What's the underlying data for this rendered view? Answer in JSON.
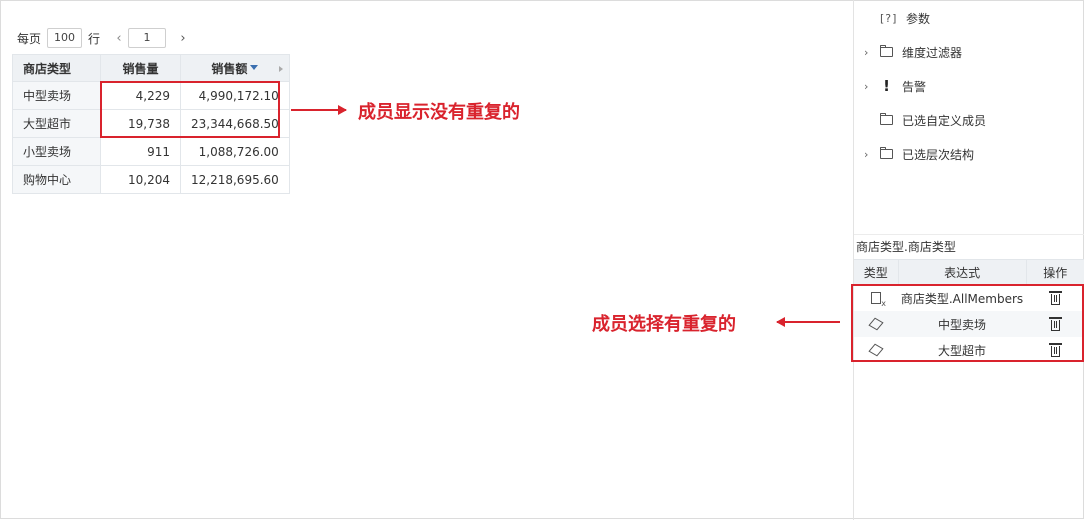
{
  "pager": {
    "prefix": "每页",
    "page_size": "100",
    "suffix": "行",
    "page": "1"
  },
  "table": {
    "headers": [
      "商店类型",
      "销售量",
      "销售额"
    ],
    "rows": [
      {
        "dim": "中型卖场",
        "qty": "4,229",
        "amount": "4,990,172.10"
      },
      {
        "dim": "大型超市",
        "qty": "19,738",
        "amount": "23,344,668.50"
      },
      {
        "dim": "小型卖场",
        "qty": "911",
        "amount": "1,088,726.00"
      },
      {
        "dim": "购物中心",
        "qty": "10,204",
        "amount": "12,218,695.60"
      }
    ]
  },
  "annotations": {
    "display_note": "成员显示没有重复的",
    "select_note": "成员选择有重复的"
  },
  "tree": {
    "param_icon": "[?]",
    "items": [
      {
        "label": "参数",
        "icon": "param-icon"
      },
      {
        "label": "维度过滤器",
        "icon": "folder-icon"
      },
      {
        "label": "告警",
        "icon": "alert-icon"
      },
      {
        "label": "已选自定义成员",
        "icon": "folder-icon"
      },
      {
        "label": "已选层次结构",
        "icon": "folder-icon"
      }
    ]
  },
  "member_panel": {
    "path": "商店类型.商店类型",
    "headers": {
      "type": "类型",
      "expr": "表达式",
      "op": "操作"
    },
    "rows": [
      {
        "icon": "formula-icon",
        "expr": "商店类型.AllMembers"
      },
      {
        "icon": "cube-icon",
        "expr": "中型卖场"
      },
      {
        "icon": "cube-icon",
        "expr": "大型超市"
      }
    ]
  },
  "colors": {
    "highlight": "#d9232d",
    "header_bg": "#eef1f4",
    "sort_icon": "#3a6fb0"
  }
}
